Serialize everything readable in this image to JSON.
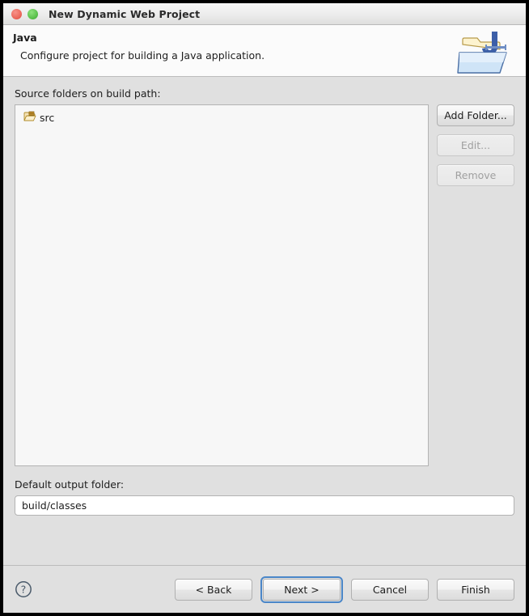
{
  "window": {
    "title": "New Dynamic Web Project",
    "controls": {
      "close_label": "close-button",
      "maximize_label": "maximize-button"
    }
  },
  "header": {
    "title": "Java",
    "description": "Configure project for building a Java application.",
    "icon": "java-folder-icon"
  },
  "source_folders": {
    "label": "Source folders on build path:",
    "items": [
      {
        "name": "src",
        "icon": "source-folder-icon"
      }
    ],
    "buttons": [
      {
        "label": "Add Folder...",
        "enabled": true
      },
      {
        "label": "Edit...",
        "enabled": false
      },
      {
        "label": "Remove",
        "enabled": false
      }
    ]
  },
  "output_folder": {
    "label": "Default output folder:",
    "value": "build/classes",
    "placeholder": ""
  },
  "footer": {
    "help_icon": "help-question-icon",
    "back_label": "< Back",
    "next_label": "Next >",
    "cancel_label": "Cancel",
    "finish_label": "Finish"
  },
  "colors": {
    "focus_ring": "#4a86c8",
    "body_background": "#e0e0e0",
    "close_button": "#ec6a5e",
    "maximize_button": "#5ec34f"
  }
}
